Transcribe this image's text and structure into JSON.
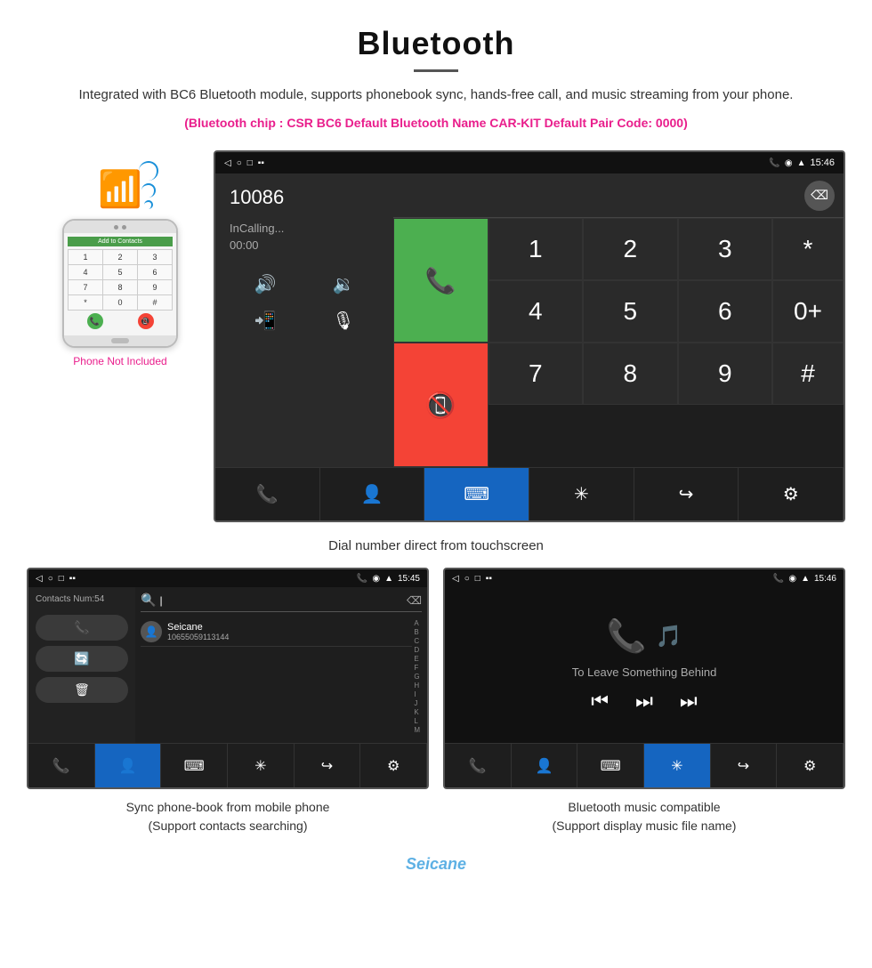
{
  "header": {
    "title": "Bluetooth",
    "description": "Integrated with BC6 Bluetooth module, supports phonebook sync, hands-free call, and music streaming from your phone.",
    "chip_info": "(Bluetooth chip : CSR BC6    Default Bluetooth Name CAR-KIT    Default Pair Code: 0000)"
  },
  "dial_screen": {
    "statusbar": {
      "time": "15:46",
      "left_icons": [
        "◁",
        "○",
        "□",
        "▪▪"
      ]
    },
    "number": "10086",
    "status": "InCalling...",
    "timer": "00:00",
    "keys": [
      "1",
      "2",
      "3",
      "*",
      "4",
      "5",
      "6",
      "0+",
      "7",
      "8",
      "9",
      "#"
    ]
  },
  "caption_main": "Dial number direct from touchscreen",
  "contacts_screen": {
    "statusbar_time": "15:45",
    "contacts_num": "Contacts Num:54",
    "contact_name": "Seicane",
    "contact_phone": "10655059113144",
    "alphabet": [
      "A",
      "B",
      "C",
      "D",
      "E",
      "F",
      "G",
      "H",
      "I",
      "J",
      "K",
      "L",
      "M"
    ]
  },
  "music_screen": {
    "statusbar_time": "15:46",
    "song_title": "To Leave Something Behind"
  },
  "bottom_captions": {
    "left": "Sync phone-book from mobile phone\n(Support contacts searching)",
    "right": "Bluetooth music compatible\n(Support display music file name)"
  },
  "phone_mockup": {
    "not_included": "Phone Not Included",
    "header_text": "Add to Contacts",
    "keys": [
      "1",
      "2",
      "3",
      "4",
      "5",
      "6",
      "7",
      "8",
      "9",
      "*",
      "0",
      "#"
    ]
  },
  "watermark": "Seicane"
}
